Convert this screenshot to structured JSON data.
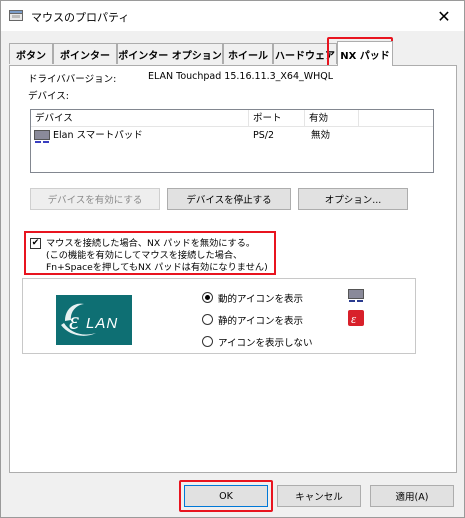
{
  "window": {
    "title": "マウスのプロパティ",
    "close_glyph": "✕"
  },
  "tabs": [
    {
      "label": "ボタン"
    },
    {
      "label": "ポインター"
    },
    {
      "label": "ポインター オプション"
    },
    {
      "label": "ホイール"
    },
    {
      "label": "ハードウェア"
    },
    {
      "label": "NX パッド",
      "active": true
    }
  ],
  "driver": {
    "label": "ドライババージョン:",
    "value": "ELAN Touchpad 15.16.11.3_X64_WHQL"
  },
  "devices": {
    "label": "デバイス:",
    "columns": [
      "デバイス",
      "ポート",
      "有効"
    ],
    "rows": [
      {
        "name": "Elan スマートパッド",
        "port": "PS/2",
        "enabled": "無効"
      }
    ]
  },
  "buttons": {
    "enable": "デバイスを有効にする",
    "stop": "デバイスを停止する",
    "options": "オプション..."
  },
  "disable_option": {
    "checked": true,
    "check_glyph": "✔",
    "line1": "マウスを接続した場合、NX パッドを無効にする。",
    "line2": "(この機能を有効にしてマウスを接続した場合、",
    "line3": "Fn+Spaceを押してもNX パッドは有効になりません)"
  },
  "icon_display": {
    "options": [
      {
        "label": "動的アイコンを表示",
        "selected": true
      },
      {
        "label": "静的アイコンを表示",
        "selected": false
      },
      {
        "label": "アイコンを表示しない",
        "selected": false
      }
    ]
  },
  "logo": {
    "text": "LAN"
  },
  "footer": {
    "ok": "OK",
    "cancel": "キャンセル",
    "apply": "適用(A)"
  },
  "colors": {
    "highlight": "#e8141f",
    "logo_teal": "#0e6f73",
    "icon_red": "#d8202a",
    "icon_navy": "#2a3b8f"
  }
}
